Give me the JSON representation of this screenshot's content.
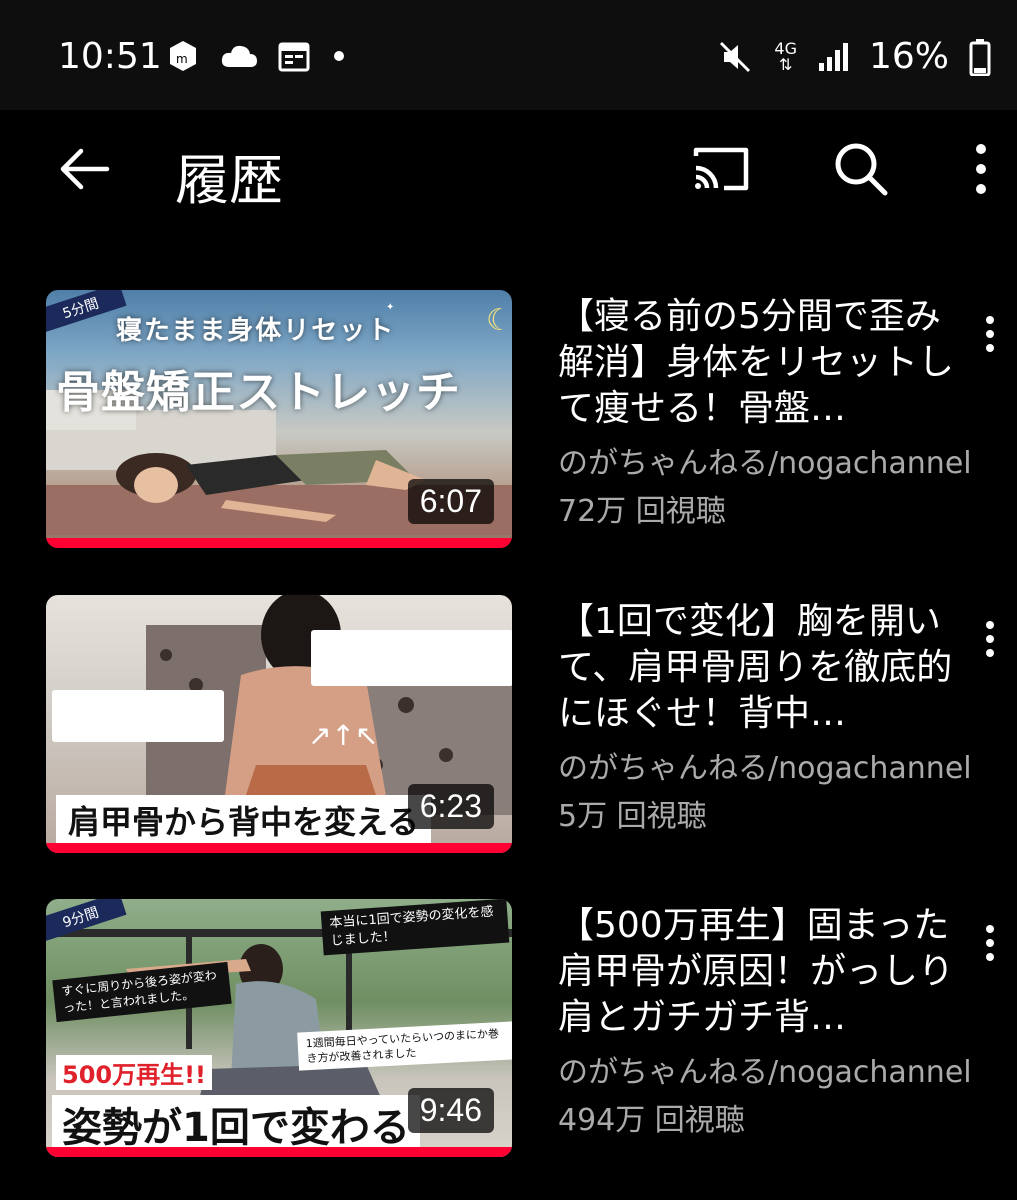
{
  "status": {
    "time": "10:51",
    "network": "4G",
    "battery": "16%"
  },
  "header": {
    "title": "履歴"
  },
  "videos": [
    {
      "title": "【寝る前の5分間で歪み解消】身体をリセットして痩せる！骨盤…",
      "channel": "のがちゃんねる/nogachannel",
      "views": "72万 回視聴",
      "duration": "6:07",
      "progress": 1.0,
      "thumb_badge": "5分間",
      "thumb_sub": "寝たまま身体リセット",
      "thumb_main": "骨盤矯正ストレッチ"
    },
    {
      "title": "【1回で変化】胸を開いて、肩甲骨周りを徹底的にほぐせ！背中…",
      "channel": "のがちゃんねる/nogachannel",
      "views": "5万 回視聴",
      "duration": "6:23",
      "progress": 1.0,
      "thumb_main": "肩甲骨から背中を変える"
    },
    {
      "title": "【500万再生】固まった肩甲骨が原因！がっしり肩とガチガチ背…",
      "channel": "のがちゃんねる/nogachannel",
      "views": "494万 回視聴",
      "duration": "9:46",
      "progress": 1.0,
      "thumb_badge": "9分間",
      "thumb_tag1": "本当に1回で姿勢の変化を感じました！",
      "thumb_tag2": "すぐに周りから後ろ姿が変わった！と言われました。",
      "thumb_tag3": "1週間毎日やっていたらいつのまにか巻き方が改善されました",
      "thumb_count": "500万再生!!",
      "thumb_main": "姿勢が1回で変わる"
    }
  ],
  "colors": {
    "background": "#000000",
    "progress": "#ff0033",
    "secondary_text": "#aaaaaa"
  }
}
